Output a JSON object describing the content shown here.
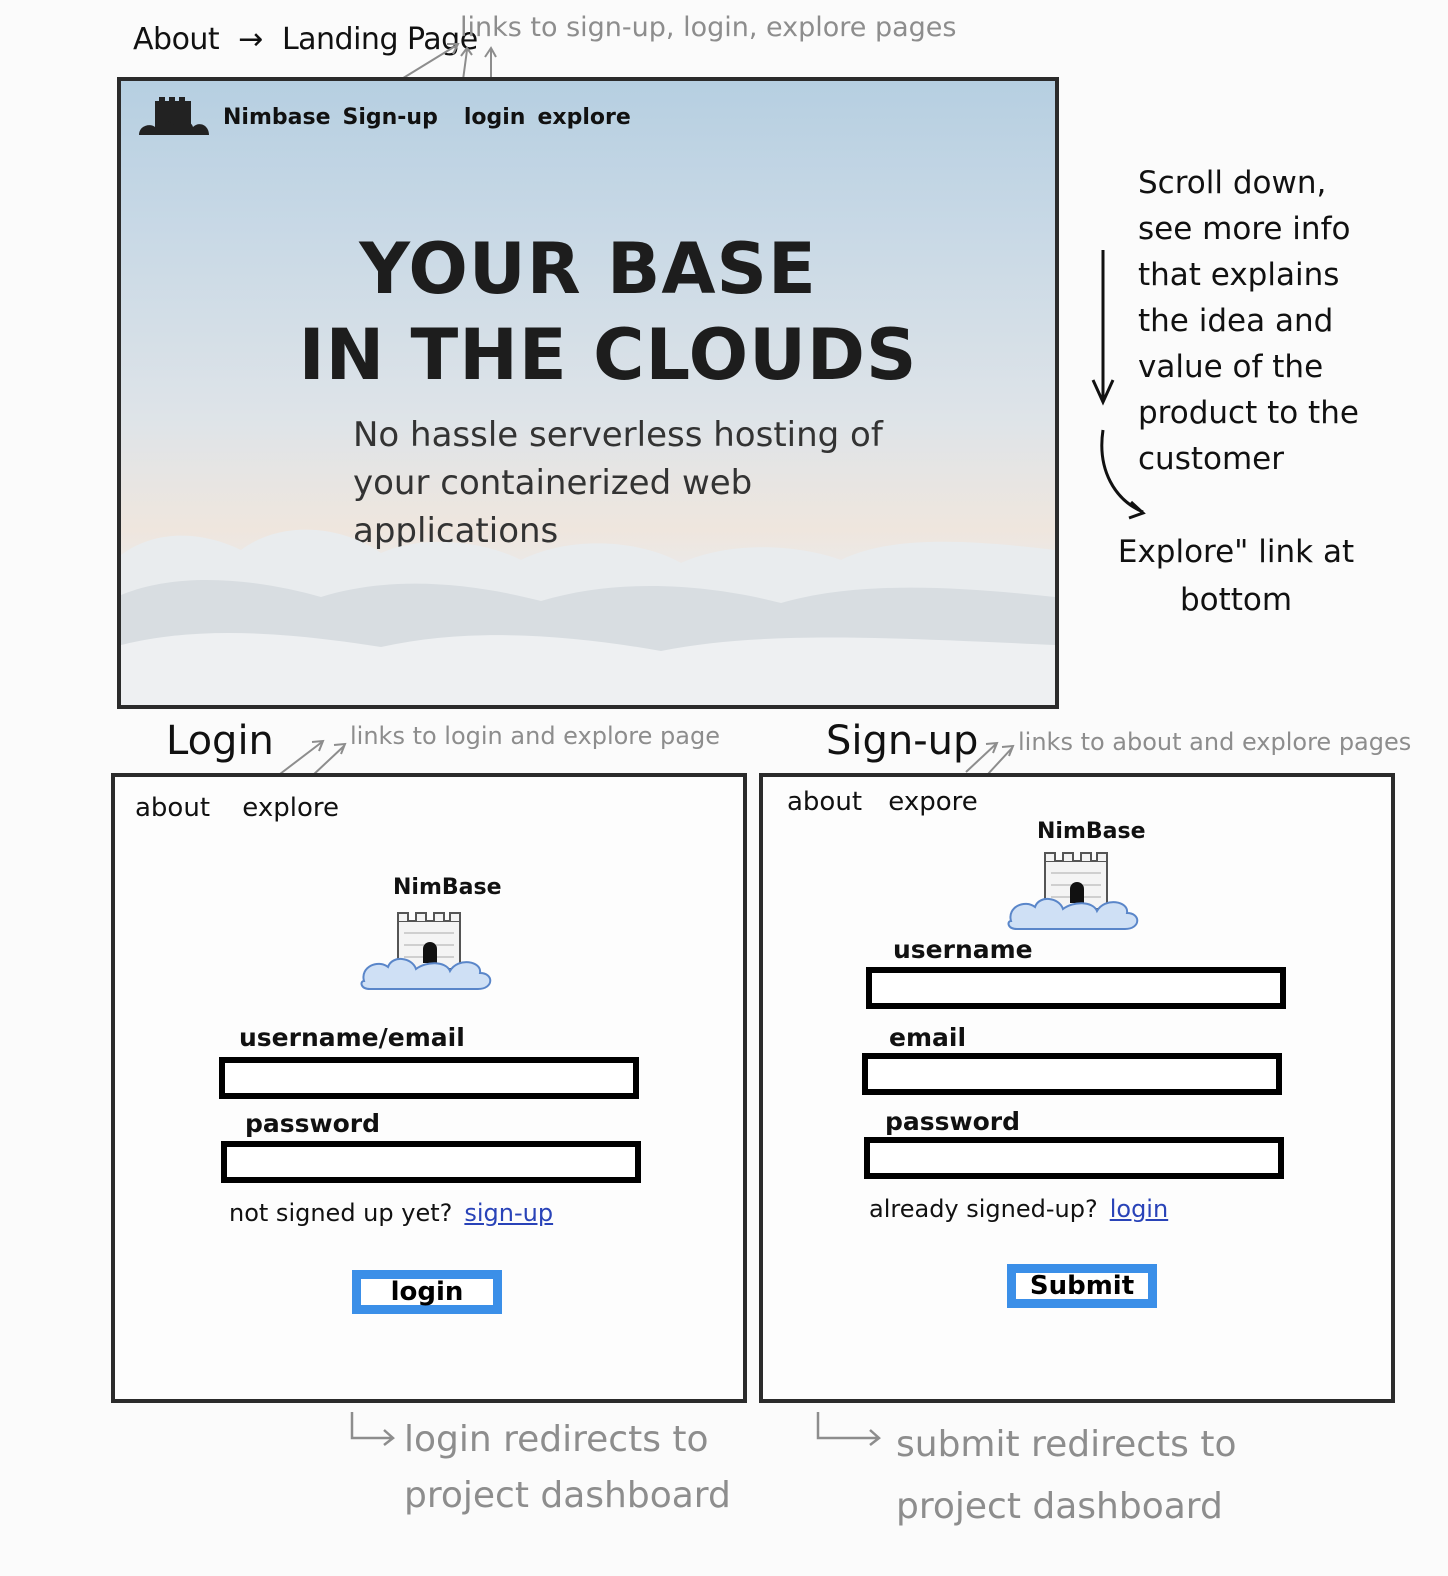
{
  "top": {
    "title_from": "About",
    "title_arrow": "→",
    "title_to": "Landing Page",
    "note": "links to sign-up, login, explore pages"
  },
  "landing": {
    "nav": {
      "brand": "Nimbase",
      "signup": "Sign-up",
      "login": "login",
      "explore": "explore"
    },
    "hero_line1": "YOUR BASE",
    "hero_line2": "IN THE CLOUDS",
    "subtitle": "No hassle serverless hosting of your containerized web applications"
  },
  "side_notes": {
    "scroll": "Scroll down, see more info that explains the idea and value of the product to the customer",
    "explore": "Explore\" link at bottom"
  },
  "login": {
    "title": "Login",
    "note": "links to login and explore page",
    "nav_about": "about",
    "nav_explore": "explore",
    "brand": "NimBase",
    "label_user": "username/email",
    "label_password": "password",
    "prompt": "not signed up yet?",
    "prompt_link": "sign-up",
    "button": "login",
    "redirect_line1": "login redirects to",
    "redirect_line2": "project dashboard"
  },
  "signup": {
    "title": "Sign-up",
    "note": "links to about and explore pages",
    "nav_about": "about",
    "nav_explore": "expore",
    "brand": "NimBase",
    "label_username": "username",
    "label_email": "email",
    "label_password": "password",
    "prompt": "already signed-up?",
    "prompt_link": "login",
    "button": "Submit",
    "redirect_line1": "submit redirects to",
    "redirect_line2": "project dashboard"
  },
  "colors": {
    "button_border": "#3b8fe8",
    "link": "#2943b8",
    "annotation": "#8d8d8d"
  },
  "icons": [
    "castle-cloud-logo",
    "arrow-right-icon",
    "arrow-down-icon",
    "curved-arrow-icon",
    "return-arrow-icon"
  ]
}
